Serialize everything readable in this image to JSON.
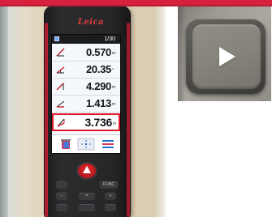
{
  "device": {
    "brand_logo": "Leica",
    "status": {
      "indicator": "1/30"
    },
    "readings": [
      {
        "value": "0.570",
        "unit": "m",
        "icon": "slope-distance-icon"
      },
      {
        "value": "20.35",
        "unit": "°",
        "icon": "tilt-angle-icon"
      },
      {
        "value": "4.290",
        "unit": "m",
        "icon": "height-icon"
      },
      {
        "value": "1.413",
        "unit": "m",
        "icon": "horizontal-distance-icon"
      },
      {
        "value": "3.736",
        "unit": "m",
        "icon": "height-tracking-icon",
        "highlighted": true
      }
    ],
    "softkeys": [
      "trash-icon",
      "camera-target-icon",
      "menu-icon"
    ],
    "keys": {
      "func": "FUNC",
      "eq": "=",
      "plus": "+",
      "minus": "−"
    }
  },
  "colors": {
    "banner": "#d6203e",
    "highlight_box": "#e0192f",
    "device_body": "#262628",
    "play_button": "#85837b"
  },
  "play_overlay": {
    "icon": "play-icon"
  }
}
